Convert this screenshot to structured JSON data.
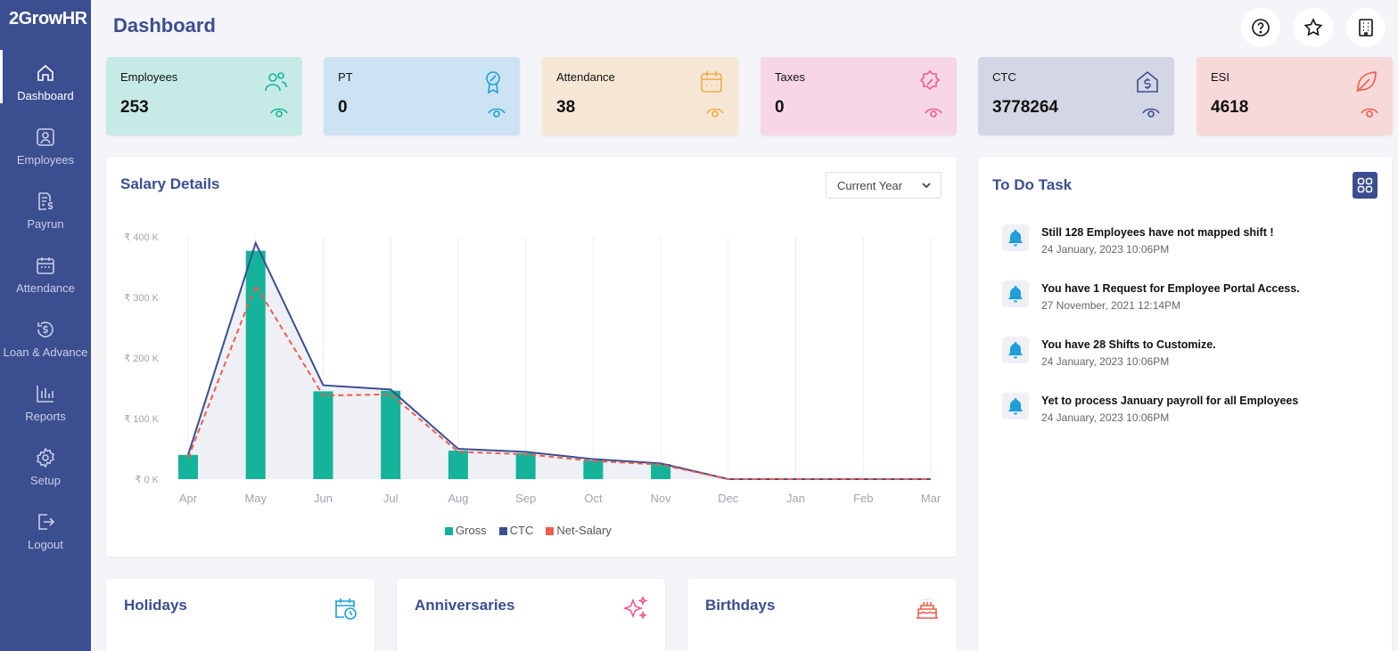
{
  "app": {
    "logo": "2GrowHR",
    "page_title": "Dashboard"
  },
  "sidebar": {
    "items": [
      {
        "label": "Dashboard",
        "icon": "home-icon",
        "active": true
      },
      {
        "label": "Employees",
        "icon": "user-icon"
      },
      {
        "label": "Payrun",
        "icon": "payrun-icon"
      },
      {
        "label": "Attendance",
        "icon": "calendar-icon"
      },
      {
        "label": "Loan & Advance",
        "icon": "loan-icon"
      },
      {
        "label": "Reports",
        "icon": "reports-icon"
      },
      {
        "label": "Setup",
        "icon": "gear-icon"
      },
      {
        "label": "Logout",
        "icon": "logout-icon"
      }
    ]
  },
  "topbar": {
    "buttons": [
      "help-icon",
      "star-icon",
      "building-icon"
    ]
  },
  "stats": [
    {
      "label": "Employees",
      "value": "253",
      "bg": "#c6ebe6",
      "accent": "#14b39a",
      "icon": "users-icon"
    },
    {
      "label": "PT",
      "value": "0",
      "bg": "#cbe3f2",
      "accent": "#1e9fd6",
      "icon": "award-icon"
    },
    {
      "label": "Attendance",
      "value": "38",
      "bg": "#f6e7d5",
      "accent": "#f5a847",
      "icon": "calendar-icon"
    },
    {
      "label": "Taxes",
      "value": "0",
      "bg": "#f7d7e5",
      "accent": "#ec5b93",
      "icon": "discount-icon"
    },
    {
      "label": "CTC",
      "value": "3778264",
      "bg": "#d3d6e4",
      "accent": "#3b4e8f",
      "icon": "dollar-house-icon"
    },
    {
      "label": "ESI",
      "value": "4618",
      "bg": "#f7d9d9",
      "accent": "#ee5d4c",
      "icon": "leaf-icon"
    }
  ],
  "salary": {
    "title": "Salary Details",
    "filter": "Current Year",
    "legend": [
      {
        "name": "Gross",
        "color": "#14b39a"
      },
      {
        "name": "CTC",
        "color": "#3b4e8f"
      },
      {
        "name": "Net-Salary",
        "color": "#ee5d4c"
      }
    ]
  },
  "chart_data": {
    "type": "bar",
    "categories": [
      "Apr",
      "May",
      "Jun",
      "Jul",
      "Aug",
      "Sep",
      "Oct",
      "Nov",
      "Dec",
      "Jan",
      "Feb",
      "Mar"
    ],
    "series": [
      {
        "name": "Gross",
        "type": "bar",
        "color": "#14b39a",
        "values": [
          40,
          377,
          145,
          146,
          47,
          43,
          31,
          25,
          0,
          0,
          0,
          0
        ]
      },
      {
        "name": "CTC",
        "type": "line",
        "color": "#3b4e8f",
        "values": [
          40,
          390,
          155,
          148,
          50,
          45,
          33,
          26,
          0,
          0,
          0,
          0
        ]
      },
      {
        "name": "Net-Salary",
        "type": "line-dashed",
        "color": "#ee5d4c",
        "values": [
          35,
          320,
          138,
          140,
          45,
          41,
          30,
          24,
          0,
          0,
          0,
          0
        ]
      }
    ],
    "yticks": [
      "₹ 0 K",
      "₹ 100 K",
      "₹ 200 K",
      "₹ 300 K",
      "₹ 400 K"
    ],
    "ylim": [
      0,
      400
    ],
    "ylabel_unit": "₹ K",
    "grid": "vertical",
    "legend": "bottom"
  },
  "todo": {
    "title": "To Do Task",
    "tasks": [
      {
        "text": "Still 128 Employees have not mapped shift !",
        "time": "24 January, 2023 10:06PM"
      },
      {
        "text": "You have 1 Request for Employee Portal Access.",
        "time": "27 November, 2021 12:14PM"
      },
      {
        "text": "You have 28 Shifts to Customize.",
        "time": "24 January, 2023 10:06PM"
      },
      {
        "text": "Yet to process January payroll for all Employees",
        "time": "24 January, 2023 10:06PM"
      }
    ]
  },
  "bottom_cards": [
    {
      "title": "Holidays",
      "icon": "calendar-clock-icon",
      "color": "#1e9fd6"
    },
    {
      "title": "Anniversaries",
      "icon": "sparkle-icon",
      "color": "#ec5b93"
    },
    {
      "title": "Birthdays",
      "icon": "cake-icon",
      "color": "#ee5d4c"
    }
  ]
}
